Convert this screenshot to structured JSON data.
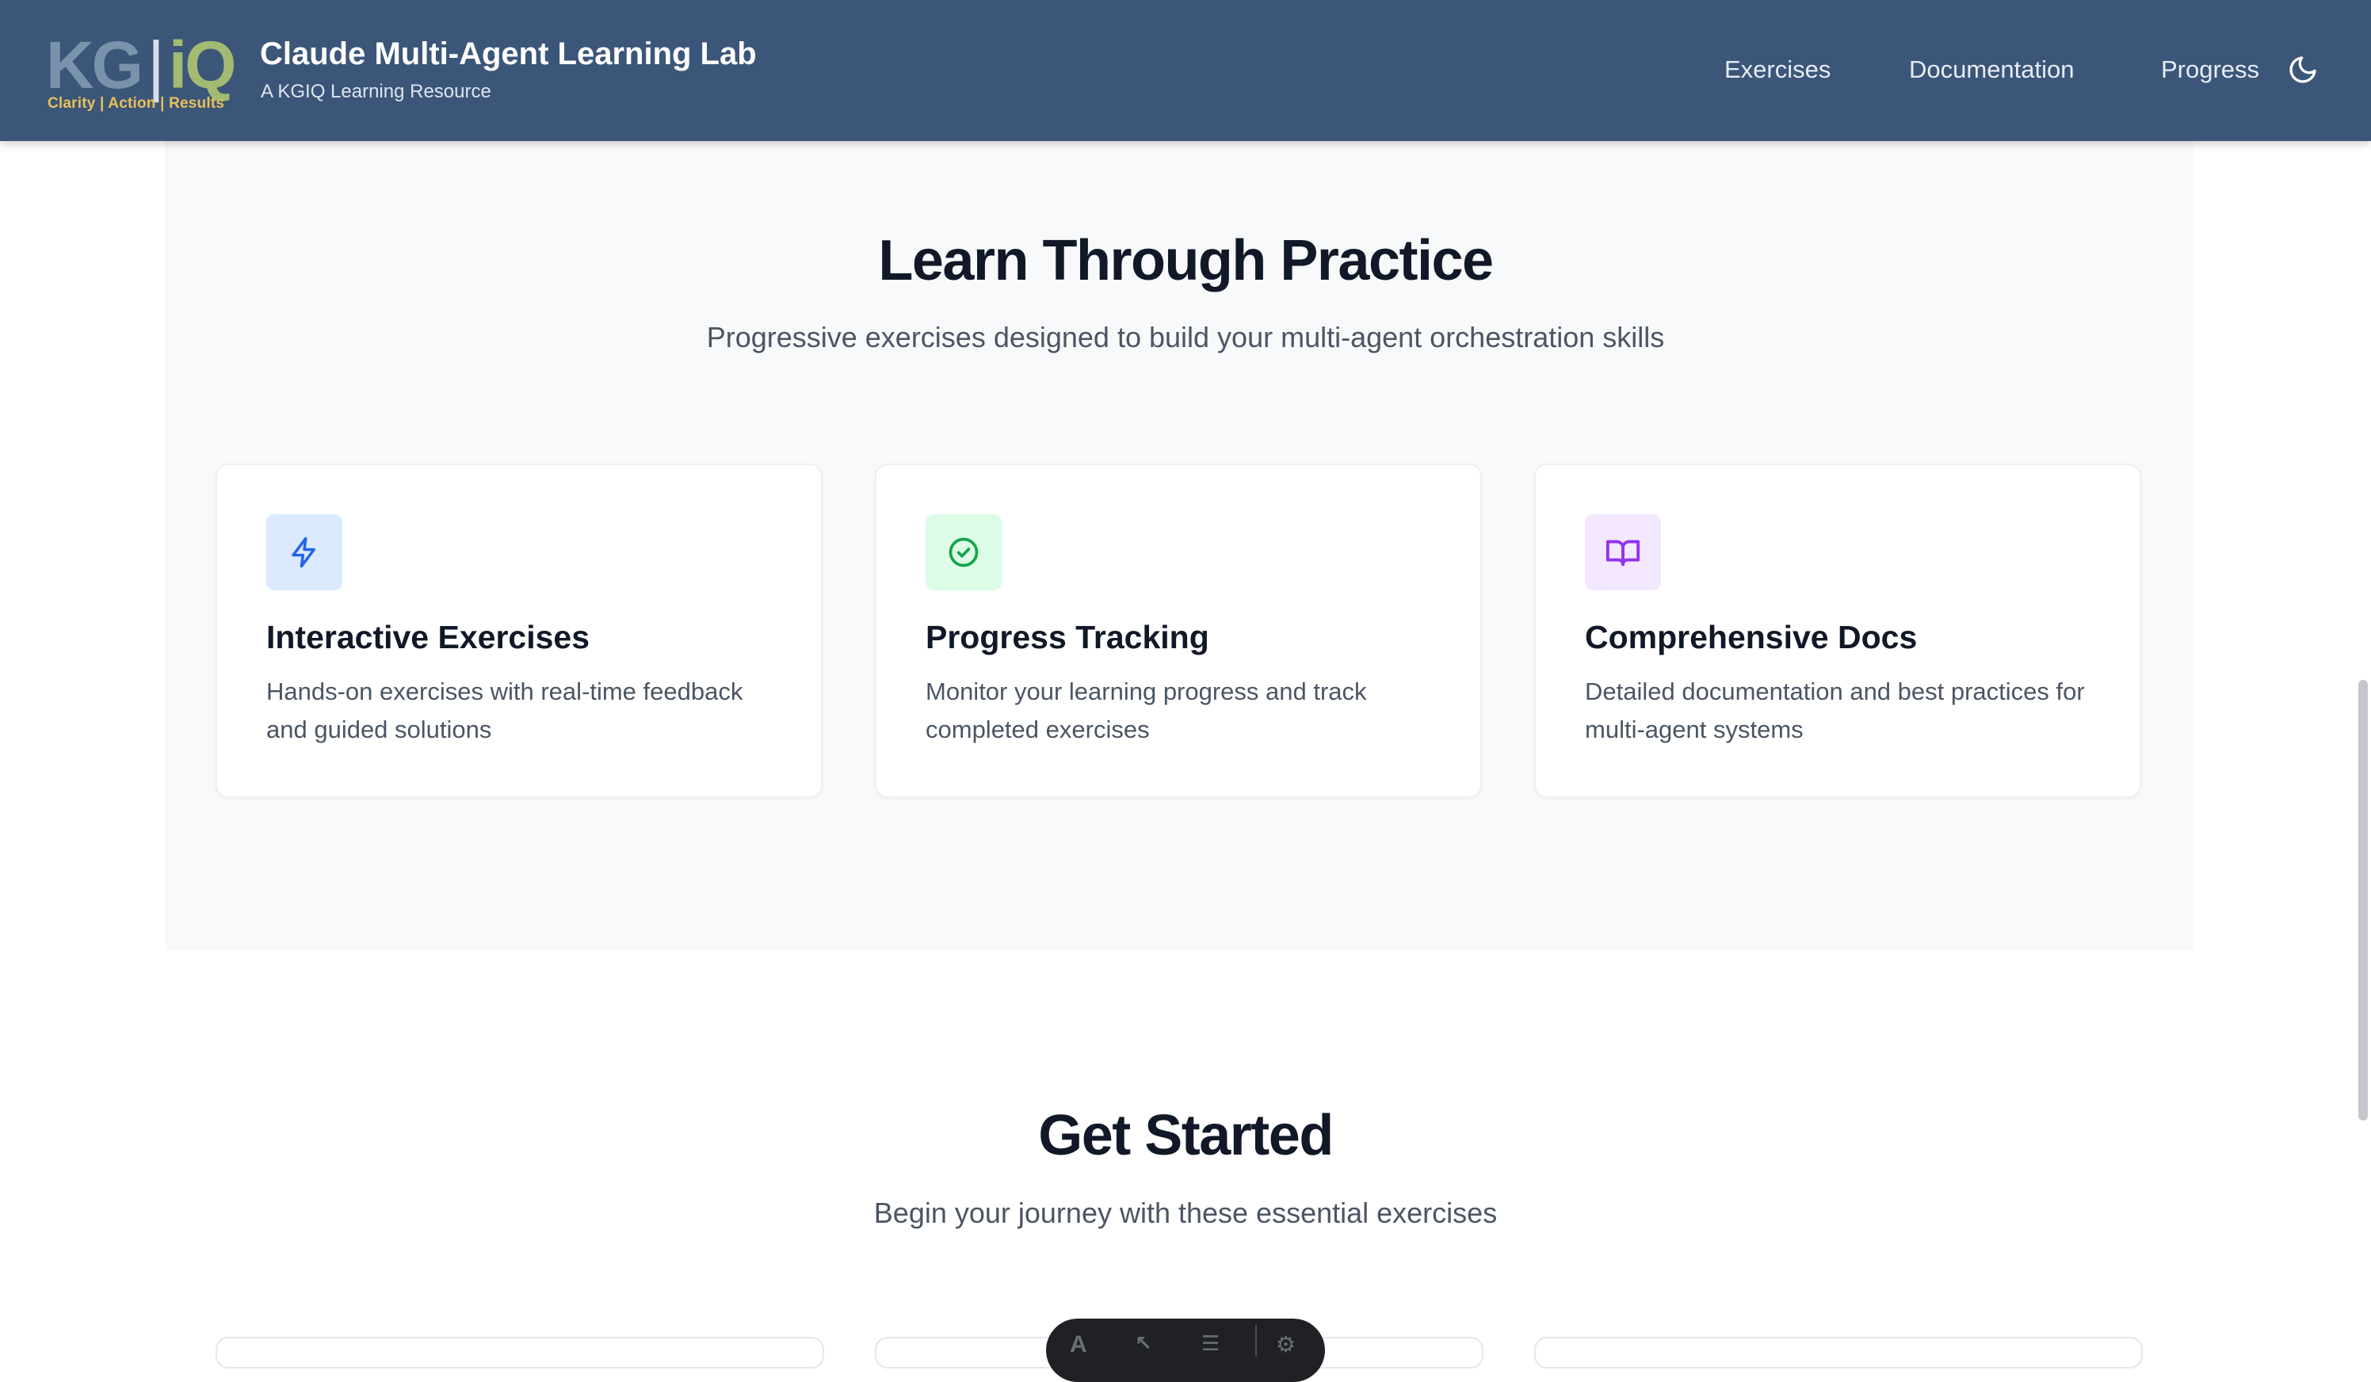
{
  "header": {
    "logo": {
      "mark_kg": "KG",
      "mark_iq": "iQ",
      "tagline": "Clarity | Action | Results"
    },
    "title": "Claude Multi-Agent Learning Lab",
    "subtitle": "A KGIQ Learning Resource",
    "nav": {
      "exercises": "Exercises",
      "documentation": "Documentation",
      "progress": "Progress"
    },
    "theme_toggle_icon": "moon-icon"
  },
  "features": {
    "title": "Learn Through Practice",
    "subtitle": "Progressive exercises designed to build your multi-agent orchestration skills",
    "cards": [
      {
        "icon": "lightning-icon",
        "icon_bg": "#dbeafe",
        "icon_color": "#2563eb",
        "title": "Interactive Exercises",
        "description": "Hands-on exercises with real-time feedback and guided solutions"
      },
      {
        "icon": "check-circle-icon",
        "icon_bg": "#dcfce7",
        "icon_color": "#16a34a",
        "title": "Progress Tracking",
        "description": "Monitor your learning progress and track completed exercises"
      },
      {
        "icon": "book-open-icon",
        "icon_bg": "#f3e8ff",
        "icon_color": "#9333ea",
        "title": "Comprehensive Docs",
        "description": "Detailed documentation and best practices for multi-agent systems"
      }
    ]
  },
  "get_started": {
    "title": "Get Started",
    "subtitle": "Begin your journey with these essential exercises"
  },
  "colors": {
    "header_bg": "#3c5679",
    "section_bg": "#f8f9fb",
    "heading": "#111827",
    "body_text": "#4b5563"
  }
}
